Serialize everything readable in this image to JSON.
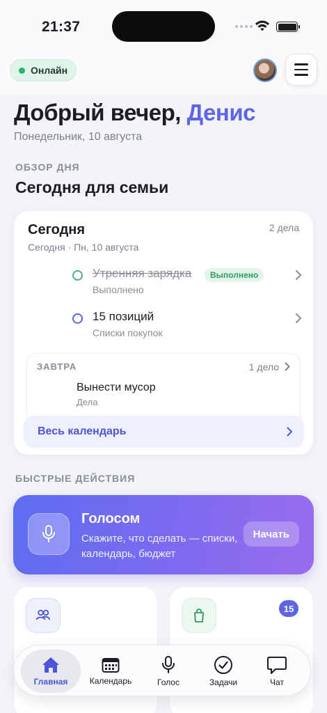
{
  "status_bar": {
    "time": "21:37"
  },
  "header": {
    "online_label": "Онлайн"
  },
  "greeting": {
    "prefix": "Добрый вечер,",
    "name": "Денис",
    "date": "Понедельник, 10 августа"
  },
  "overview": {
    "section_label": "ОБЗОР ДНЯ",
    "title": "Сегодня для семьи"
  },
  "today_card": {
    "title": "Сегодня",
    "count": "2 дела",
    "subtitle": "Сегодня · Пн, 10 августа",
    "tasks": [
      {
        "title": "Утренняя зарядка",
        "badge": "Выполнено",
        "subtitle": "Выполнено",
        "status": "done",
        "color": "#4fb07e"
      },
      {
        "title": "15 позиций",
        "subtitle": "Списки покупок",
        "status": "open",
        "color": "#5d64e8"
      }
    ],
    "tomorrow": {
      "label": "ЗАВТРА",
      "count": "1 дело",
      "task_title": "Вынести мусор",
      "task_subtitle": "Дела"
    },
    "calendar_link": "Весь календарь"
  },
  "quick_actions": {
    "section_label": "БЫСТРЫЕ ДЕЙСТВИЯ",
    "voice": {
      "title": "Голосом",
      "description": "Скажите, что сделать — списки, календарь, бюджет",
      "button": "Начать"
    },
    "tiles": [
      {
        "icon": "people-icon"
      },
      {
        "icon": "shopping-bag-icon",
        "badge": "15"
      }
    ]
  },
  "tab_bar": {
    "items": [
      {
        "label": "Главная",
        "icon": "home-icon",
        "active": true
      },
      {
        "label": "Календарь",
        "icon": "calendar-icon"
      },
      {
        "label": "Голос",
        "icon": "mic-icon"
      },
      {
        "label": "Задачи",
        "icon": "check-circle-icon"
      },
      {
        "label": "Чат",
        "icon": "chat-icon"
      }
    ]
  },
  "colors": {
    "accent": "#5d64e8",
    "online": "#2cb36b",
    "done": "#4fb07e",
    "voice_gradient": [
      "#5e6df1",
      "#9a6cee"
    ]
  }
}
